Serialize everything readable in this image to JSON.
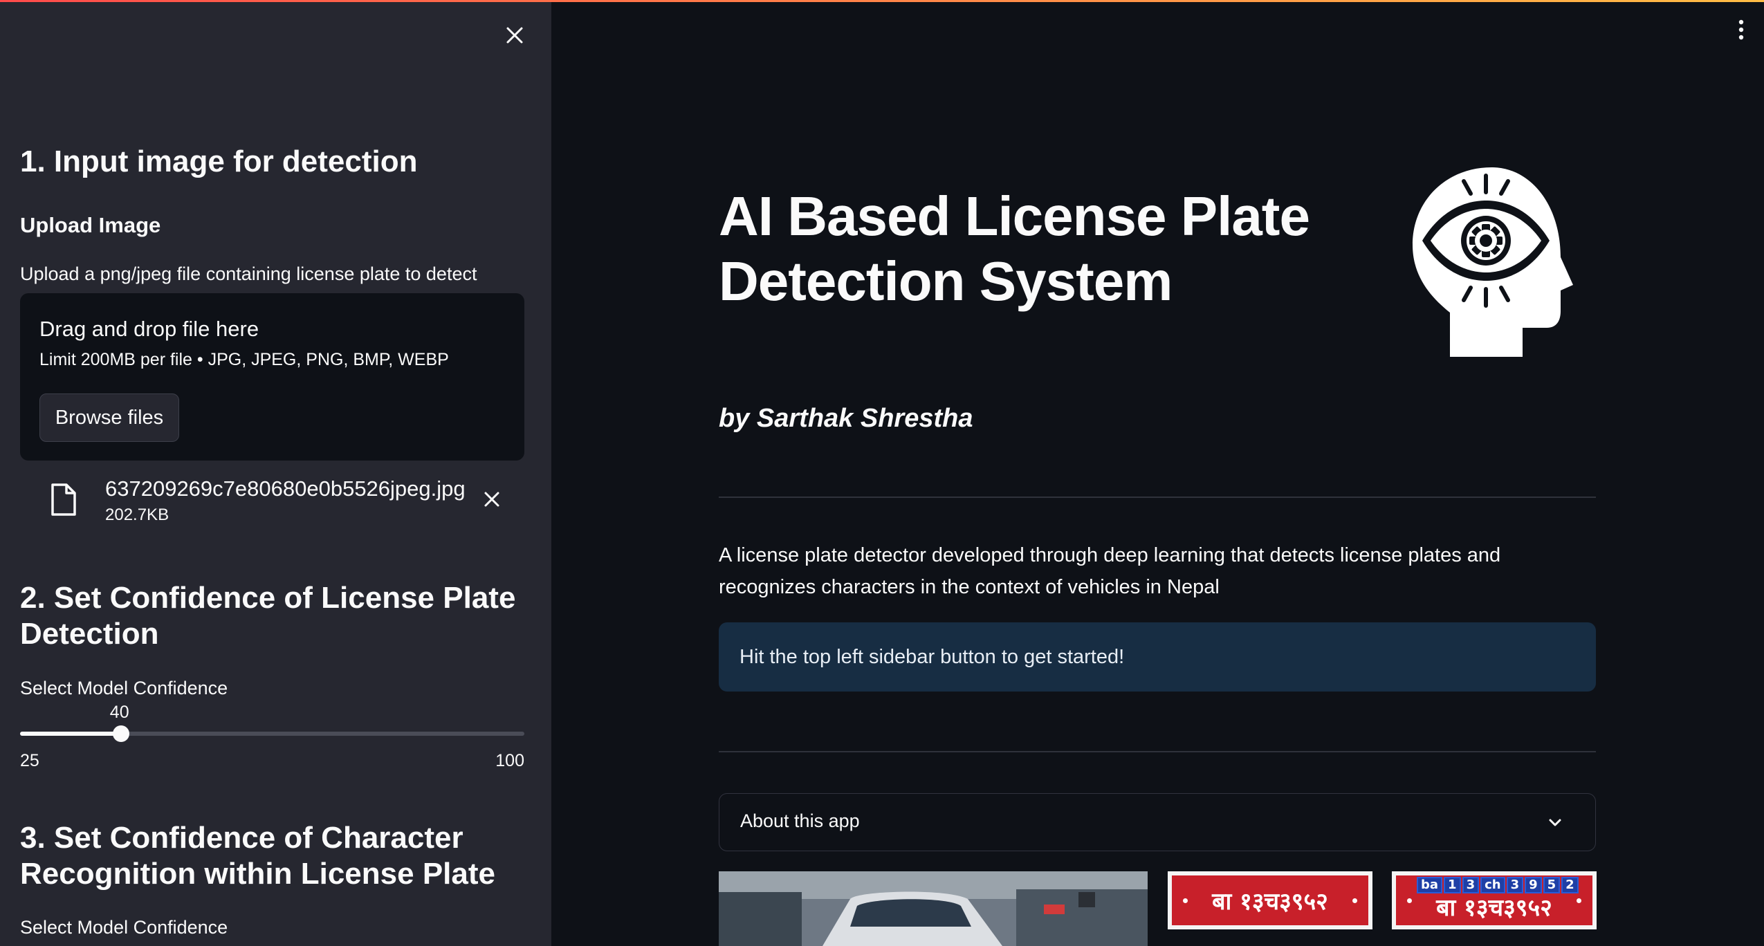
{
  "sidebar": {
    "section1_title": "1. Input image for detection",
    "upload_heading": "Upload Image",
    "upload_label": "Upload a png/jpeg file containing license plate to detect",
    "dropzone_title": "Drag and drop file here",
    "dropzone_limit": "Limit 200MB per file • JPG, JPEG, PNG, BMP, WEBP",
    "browse_label": "Browse files",
    "file_name": "637209269c7e80680e0b5526jpeg.jpg",
    "file_size": "202.7KB",
    "section2_title": "2. Set Confidence of License Plate Detection",
    "slider1_label": "Select Model Confidence",
    "slider1_value": "40",
    "slider1_min": "25",
    "slider1_max": "100",
    "slider1_level": 40,
    "section3_title": "3. Set Confidence of Character Recognition within License Plate",
    "slider2_label": "Select Model Confidence"
  },
  "main": {
    "title": "AI Based License Plate Detection System",
    "byline": "by Sarthak Shrestha",
    "description": "A license plate detector developed through deep learning that detects license plates and recognizes characters in the context of vehicles in Nepal",
    "info": "Hit the top left sidebar button to get started!",
    "expander_label": "About this app",
    "plate1_text": "बा १३च३९५२",
    "plate2_text": "बा १३च३९५२",
    "plate2_boxes": [
      "ba",
      "1",
      "3",
      "ch",
      "3",
      "9",
      "5",
      "2"
    ]
  },
  "colors": {
    "accent": "#ff4b4b",
    "sidebar_bg": "#262730",
    "main_bg": "#0e1117",
    "info_bg": "#172d43",
    "plate_red": "#c8202a"
  },
  "icons": [
    "close-icon",
    "file-icon",
    "remove-icon",
    "menu-icon",
    "brain-eye-icon",
    "chevron-down-icon"
  ]
}
